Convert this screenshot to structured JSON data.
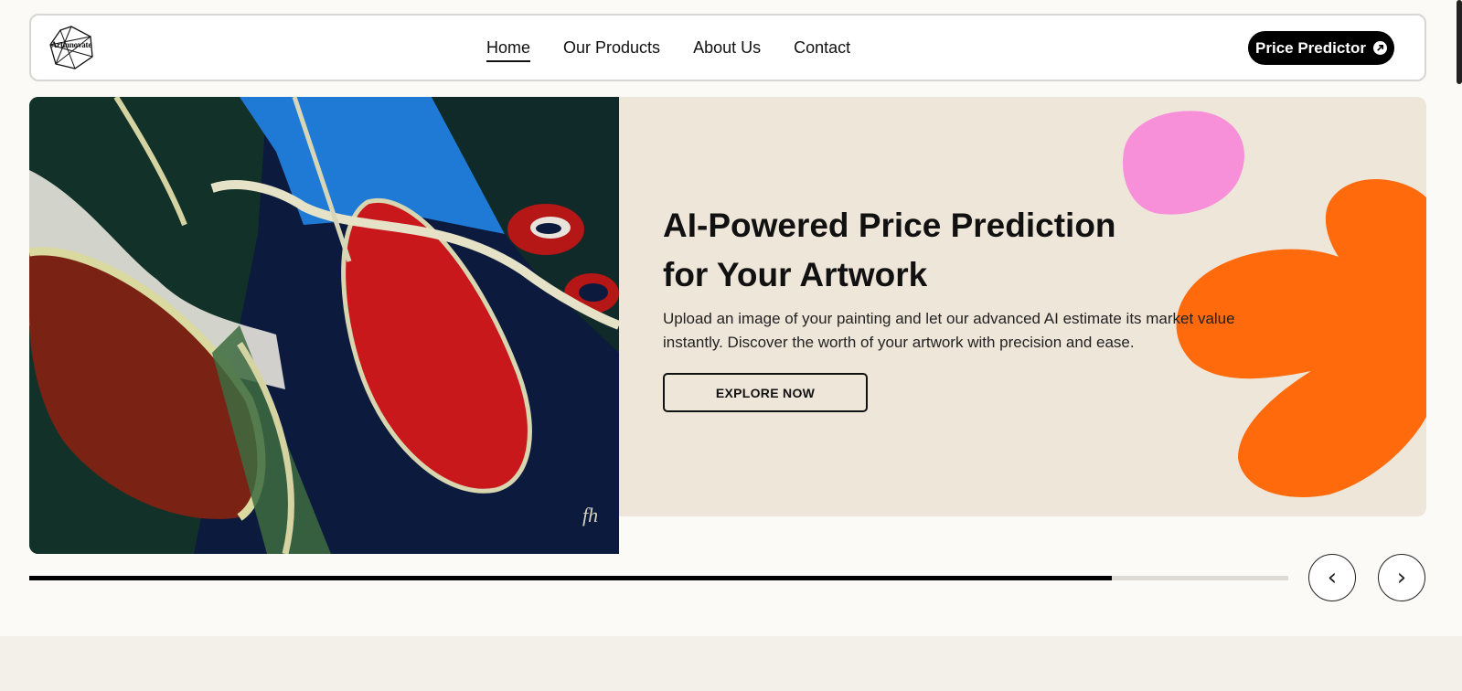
{
  "header": {
    "logo_text": "Artinnovate",
    "nav": [
      {
        "label": "Home",
        "active": true
      },
      {
        "label": "Our Products",
        "active": false
      },
      {
        "label": "About Us",
        "active": false
      },
      {
        "label": "Contact",
        "active": false
      }
    ],
    "cta_label": "Price Predictor",
    "cta_icon": "arrow-up-right-icon"
  },
  "hero": {
    "headline_line1": "AI-Powered Price Prediction",
    "headline_line2": "for Your Artwork",
    "description": "Upload an image of your painting and let our advanced AI estimate its market value instantly. Discover the worth of your artwork with precision and ease.",
    "button_label": "EXPLORE NOW"
  },
  "slider": {
    "progress": 0.86,
    "prev_label": "‹",
    "next_label": "›"
  },
  "colors": {
    "accent": "#000000",
    "panel_bg": "#efe6da",
    "pink_blob": "#f78fd9",
    "orange_flower": "#ff6a0d"
  }
}
